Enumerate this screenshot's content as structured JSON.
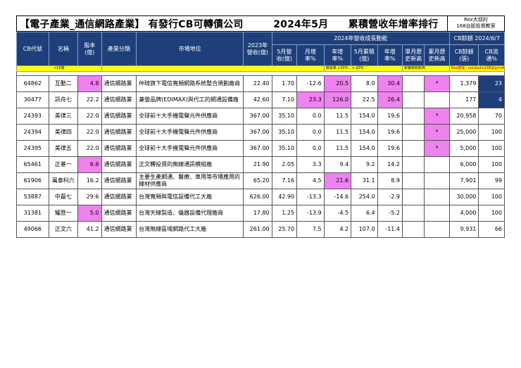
{
  "title": "【電子產業_通信網路產業】 有發行CB可轉債公司　　　2024年5月　　累積營收年增率排行",
  "brand": {
    "line1": "Rex大叔的",
    "line2": "168台股投資教室"
  },
  "header": {
    "cb_code": "CB代號",
    "name": "名稱",
    "capital": "股本(億)",
    "industry": "產業分類",
    "market_position": "市場地位",
    "revenue_2023": "2023年營收(億)",
    "growth_group": "2024年營收成長動能",
    "cb_balance_group": "CB餘額 2024/6/7",
    "may_revenue": "5月營收(億)",
    "mom": "月增率%",
    "yoy": "年增率%",
    "may_cum": "5月累積(億)",
    "cum_yoy": "年增率%",
    "monthly_high": "單月歷史新高",
    "cum_high": "累月歷史新高",
    "cb_amount": "CB餘額(張)",
    "cb_ratio": "CB流通%"
  },
  "notes": {
    "capital": "<10億",
    "growth": "增長率 >20% ; <-20%",
    "cum_note": "累積營收新高",
    "contact": "Rex整理 : rexdashu168@gmail.com"
  },
  "rows": [
    {
      "code": "64862",
      "name": "互動二",
      "capital": "4.8",
      "industry": "通信網路業",
      "position": "仲琦旗下電信寬頻網路系統整合規劃廠商",
      "rev2023": "22.40",
      "may": "1.70",
      "mom": "-12.6",
      "yoy": "20.5",
      "cum": "8.0",
      "cumyoy": "30.4",
      "mhigh": "",
      "chigh": "*",
      "cbamt": "1,379",
      "cbpct": "23",
      "hl": [
        "capital",
        "yoy",
        "cumyoy",
        "chigh"
      ],
      "nv": [
        "cbpct"
      ]
    },
    {
      "code": "30477",
      "name": "訊舟七",
      "capital": "22.2",
      "industry": "通信網路業",
      "position": "兼營品牌(EDIMAX)與代工的網通設備廠",
      "rev2023": "42.60",
      "may": "7.10",
      "mom": "23.3",
      "yoy": "126.0",
      "cum": "22.5",
      "cumyoy": "26.4",
      "mhigh": "",
      "chigh": "",
      "cbamt": "177",
      "cbpct": "4",
      "hl": [
        "mom",
        "yoy",
        "cumyoy"
      ],
      "nv": [
        "cbpct"
      ]
    },
    {
      "code": "24393",
      "name": "美律三",
      "capital": "22.0",
      "industry": "通信網路業",
      "position": "全球前十大手機電聲元件供應商",
      "rev2023": "367.00",
      "may": "35.10",
      "mom": "0.0",
      "yoy": "11.5",
      "cum": "154.0",
      "cumyoy": "19.6",
      "mhigh": "",
      "chigh": "*",
      "cbamt": "20,958",
      "cbpct": "70",
      "hl": [
        "chigh"
      ],
      "nv": []
    },
    {
      "code": "24394",
      "name": "美律四",
      "capital": "22.0",
      "industry": "通信網路業",
      "position": "全球前十大手機電聲元件供應商",
      "rev2023": "367.00",
      "may": "35.10",
      "mom": "0.0",
      "yoy": "11.5",
      "cum": "154.0",
      "cumyoy": "19.6",
      "mhigh": "",
      "chigh": "*",
      "cbamt": "25,000",
      "cbpct": "100",
      "hl": [
        "chigh"
      ],
      "nv": []
    },
    {
      "code": "24395",
      "name": "美律五",
      "capital": "22.0",
      "industry": "通信網路業",
      "position": "全球前十大手機電聲元件供應商",
      "rev2023": "367.00",
      "may": "35.10",
      "mom": "0.0",
      "yoy": "11.5",
      "cum": "154.0",
      "cumyoy": "19.6",
      "mhigh": "",
      "chigh": "*",
      "cbamt": "5,000",
      "cbpct": "100",
      "hl": [
        "chigh"
      ],
      "nv": []
    },
    {
      "code": "65461",
      "name": "正基一",
      "capital": "6.6",
      "industry": "通信網路業",
      "position": "正文轉投資的無線通訊模組廠",
      "rev2023": "21.90",
      "may": "2.05",
      "mom": "3.3",
      "yoy": "9.4",
      "cum": "9.2",
      "cumyoy": "14.2",
      "mhigh": "",
      "chigh": "",
      "cbamt": "6,000",
      "cbpct": "100",
      "hl": [
        "capital"
      ],
      "nv": []
    },
    {
      "code": "61906",
      "name": "萬泰科六",
      "capital": "16.2",
      "industry": "通信網路業",
      "position": "主要生產網通、醫療、車用等市場應用的線材供應商",
      "rev2023": "65.20",
      "may": "7.16",
      "mom": "4.5",
      "yoy": "21.6",
      "cum": "31.1",
      "cumyoy": "8.9",
      "mhigh": "",
      "chigh": "",
      "cbamt": "7,901",
      "cbpct": "99",
      "hl": [
        "yoy"
      ],
      "nv": []
    },
    {
      "code": "53887",
      "name": "中磊七",
      "capital": "29.6",
      "industry": "通信網路業",
      "position": "台灣寬頻與電信設備代工大廠",
      "rev2023": "626.00",
      "may": "42.90",
      "mom": "-13.3",
      "yoy": "-14.6",
      "cum": "254.0",
      "cumyoy": "-2.9",
      "mhigh": "",
      "chigh": "",
      "cbamt": "30,000",
      "cbpct": "100",
      "hl": [],
      "nv": []
    },
    {
      "code": "31381",
      "name": "耀登一",
      "capital": "5.0",
      "industry": "通信網路業",
      "position": "台灣天線製造、儀器設備代理廠商",
      "rev2023": "17.80",
      "may": "1.25",
      "mom": "-13.9",
      "yoy": "-4.5",
      "cum": "6.4",
      "cumyoy": "-5.2",
      "mhigh": "",
      "chigh": "",
      "cbamt": "4,000",
      "cbpct": "100",
      "hl": [
        "capital"
      ],
      "nv": []
    },
    {
      "code": "49066",
      "name": "正文六",
      "capital": "41.2",
      "industry": "通信網路業",
      "position": "台灣無線區域網路代工大廠",
      "rev2023": "261.00",
      "may": "25.70",
      "mom": "7.5",
      "yoy": "4.2",
      "cum": "107.0",
      "cumyoy": "-11.4",
      "mhigh": "",
      "chigh": "",
      "cbamt": "9,931",
      "cbpct": "66",
      "hl": [],
      "nv": []
    }
  ]
}
